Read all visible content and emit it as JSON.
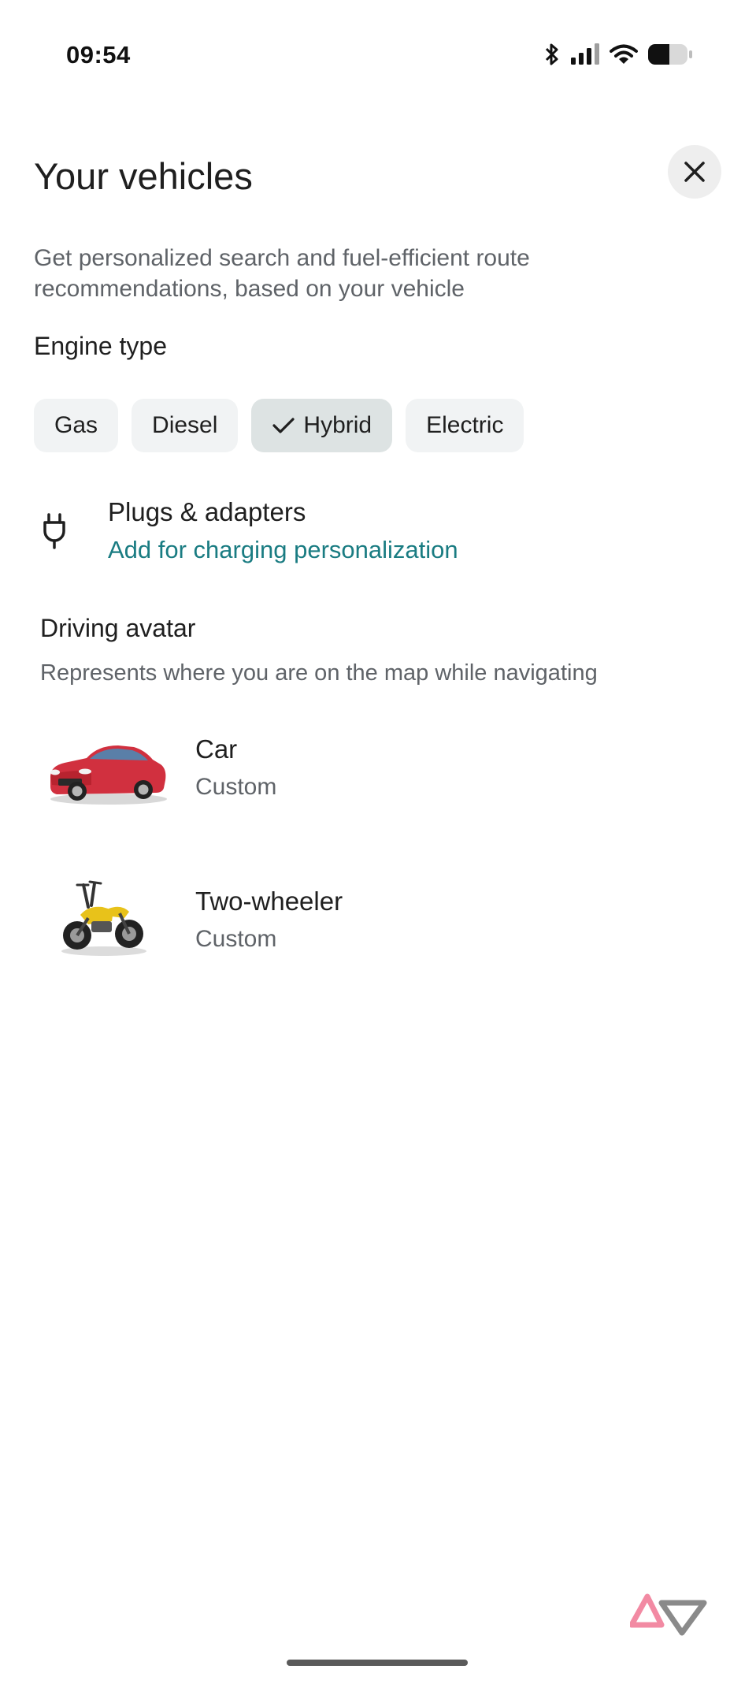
{
  "status_bar": {
    "time": "09:54",
    "icons": [
      "bluetooth-icon",
      "signal-icon",
      "wifi-icon",
      "battery-icon"
    ]
  },
  "header": {
    "title": "Your vehicles",
    "close_icon": "close-icon"
  },
  "subtitle": "Get personalized search and fuel-efficient route recommendations, based on your vehicle",
  "engine": {
    "label": "Engine type",
    "options": [
      {
        "label": "Gas",
        "selected": false
      },
      {
        "label": "Diesel",
        "selected": false
      },
      {
        "label": "Hybrid",
        "selected": true
      },
      {
        "label": "Electric",
        "selected": false
      }
    ]
  },
  "plugs": {
    "icon": "plug-icon",
    "title": "Plugs & adapters",
    "link": "Add for charging personalization"
  },
  "avatar": {
    "label": "Driving avatar",
    "description": "Represents where you are on the map while navigating",
    "vehicles": [
      {
        "name": "Car",
        "subtitle": "Custom",
        "icon": "car-image"
      },
      {
        "name": "Two-wheeler",
        "subtitle": "Custom",
        "icon": "motorcycle-image"
      }
    ]
  },
  "colors": {
    "link": "#1a7c82",
    "chip": "#f1f3f4",
    "chip_selected": "#dde3e3"
  }
}
